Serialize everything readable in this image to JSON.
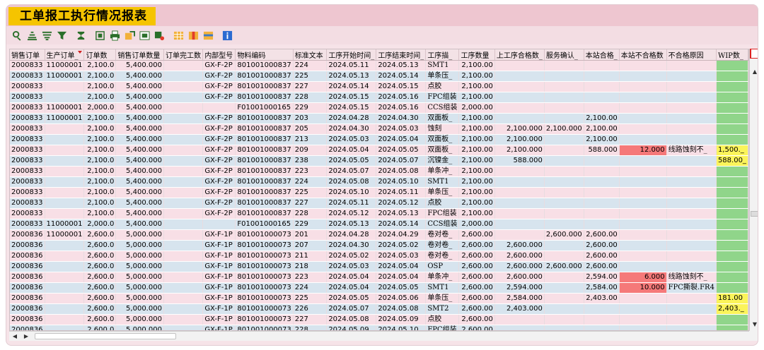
{
  "title": "工单报工执行情况报表",
  "toolbar": {
    "icons": [
      "details-icon",
      "sort-ascending-icon",
      "sort-descending-icon",
      "filter-icon",
      "sum-icon",
      "subtotal-icon",
      "print-icon",
      "export-icon",
      "spreadsheet-icon",
      "layout-icon",
      "grid-icon",
      "column-icon",
      "info-icon"
    ]
  },
  "colors": {
    "title_bg": "#f5c400",
    "row_pink": "#f8dfe6",
    "row_blue": "#d7e4ee",
    "red": "#f57979",
    "yellow": "#fbf45a",
    "wip": "#90d58a"
  },
  "table": {
    "headers": [
      "销售订单",
      "生产订单_",
      "订单数",
      "销售订单数量",
      "订单完工数",
      "内部型号",
      "物料编码",
      "标准文本",
      "工序开始时间_",
      "工序结束时间_",
      "工序描_",
      "工序数量",
      "上工序合格数_",
      "服务确认_",
      "本站合格_",
      "本站不合格数",
      "不合格原因",
      "WIP数_"
    ],
    "rows": [
      [
        "2000833",
        "11000001",
        "2,100.0",
        "5,400.000",
        "",
        "GX-F-2P",
        "801001000837",
        "224",
        "2024.05.11",
        "2024.05.13",
        "SMT1",
        "2,100.00",
        "",
        "",
        "",
        "",
        "",
        ""
      ],
      [
        "2000833",
        "11000001",
        "2,100.0",
        "5,400.000",
        "",
        "GX-F-2P",
        "801001000837",
        "225",
        "2024.05.13",
        "2024.05.14",
        "单条压_",
        "2,100.00",
        "",
        "",
        "",
        "",
        "",
        ""
      ],
      [
        "2000833",
        "",
        "2,100.0",
        "5,400.000",
        "",
        "GX-F-2P",
        "801001000837",
        "227",
        "2024.05.14",
        "2024.05.15",
        "点胶",
        "2,100.00",
        "",
        "",
        "",
        "",
        "",
        ""
      ],
      [
        "2000833",
        "",
        "2,100.0",
        "5,400.000",
        "",
        "GX-F-2P",
        "801001000837",
        "228",
        "2024.05.15",
        "2024.05.16",
        "FPC组装",
        "2,100.00",
        "",
        "",
        "",
        "",
        "",
        ""
      ],
      [
        "2000833",
        "11000001",
        "2,000.0",
        "5,400.000",
        "",
        "",
        "F01001000165",
        "229",
        "2024.05.15",
        "2024.05.16",
        "CCS组装",
        "2,000.00",
        "",
        "",
        "",
        "",
        "",
        ""
      ],
      [
        "2000833",
        "11000001",
        "2,100.0",
        "5,400.000",
        "",
        "GX-F-2P",
        "801001000837",
        "203",
        "2024.04.28",
        "2024.04.30",
        "双面板_",
        "2,100.00",
        "",
        "",
        "2,100.00",
        "",
        "",
        ""
      ],
      [
        "2000833",
        "",
        "2,100.0",
        "5,400.000",
        "",
        "GX-F-2P",
        "801001000837",
        "205",
        "2024.04.30",
        "2024.05.03",
        "蚀刻",
        "2,100.00",
        "2,100.000",
        "2,100.000",
        "2,100.00",
        "",
        "",
        ""
      ],
      [
        "2000833",
        "",
        "2,100.0",
        "5,400.000",
        "",
        "GX-F-2P",
        "801001000837",
        "213",
        "2024.05.03",
        "2024.05.04",
        "双面板_",
        "2,100.00",
        "2,100.000",
        "",
        "2,100.00",
        "",
        "",
        ""
      ],
      [
        "2000833",
        "",
        "2,100.0",
        "5,400.000",
        "",
        "GX-F-2P",
        "801001000837",
        "209",
        "2024.05.04",
        "2024.05.05",
        "双面板_",
        "2,100.00",
        "2,100.000",
        "",
        "588.000",
        "12.000",
        "线路蚀刻不_",
        "1,500._"
      ],
      [
        "2000833",
        "",
        "2,100.0",
        "5,400.000",
        "",
        "GX-F-2P",
        "801001000837",
        "238",
        "2024.05.05",
        "2024.05.07",
        "沉镍金_",
        "2,100.00",
        "588.000",
        "",
        "",
        "",
        "",
        "588.00_"
      ],
      [
        "2000833",
        "",
        "2,100.0",
        "5,400.000",
        "",
        "GX-F-2P",
        "801001000837",
        "223",
        "2024.05.07",
        "2024.05.08",
        "单条冲_",
        "2,100.00",
        "",
        "",
        "",
        "",
        "",
        ""
      ],
      [
        "2000833",
        "",
        "2,100.0",
        "5,400.000",
        "",
        "GX-F-2P",
        "801001000837",
        "224",
        "2024.05.08",
        "2024.05.10",
        "SMT1",
        "2,100.00",
        "",
        "",
        "",
        "",
        "",
        ""
      ],
      [
        "2000833",
        "",
        "2,100.0",
        "5,400.000",
        "",
        "GX-F-2P",
        "801001000837",
        "225",
        "2024.05.10",
        "2024.05.11",
        "单条压_",
        "2,100.00",
        "",
        "",
        "",
        "",
        "",
        ""
      ],
      [
        "2000833",
        "",
        "2,100.0",
        "5,400.000",
        "",
        "GX-F-2P",
        "801001000837",
        "227",
        "2024.05.11",
        "2024.05.12",
        "点胶",
        "2,100.00",
        "",
        "",
        "",
        "",
        "",
        ""
      ],
      [
        "2000833",
        "",
        "2,100.0",
        "5,400.000",
        "",
        "GX-F-2P",
        "801001000837",
        "228",
        "2024.05.12",
        "2024.05.13",
        "FPC组装",
        "2,100.00",
        "",
        "",
        "",
        "",
        "",
        ""
      ],
      [
        "2000833",
        "11000001",
        "2,000.0",
        "5,400.000",
        "",
        "",
        "F01001000165",
        "229",
        "2024.05.13",
        "2024.05.14",
        "CCS组装",
        "2,000.00",
        "",
        "",
        "",
        "",
        "",
        ""
      ],
      [
        "2000836",
        "11000001",
        "2,600.0",
        "5,000.000",
        "",
        "GX-F-1P",
        "801001000073",
        "201",
        "2024.04.28",
        "2024.04.29",
        "卷对卷_",
        "2,600.00",
        "",
        "2,600.000",
        "2,600.00",
        "",
        "",
        ""
      ],
      [
        "2000836",
        "",
        "2,600.0",
        "5,000.000",
        "",
        "GX-F-1P",
        "801001000073",
        "207",
        "2024.04.30",
        "2024.05.02",
        "卷对卷_",
        "2,600.00",
        "2,600.000",
        "",
        "2,600.00",
        "",
        "",
        ""
      ],
      [
        "2000836",
        "",
        "2,600.0",
        "5,000.000",
        "",
        "GX-F-1P",
        "801001000073",
        "211",
        "2024.05.02",
        "2024.05.03",
        "卷对卷_",
        "2,600.00",
        "2,600.000",
        "",
        "2,600.00",
        "",
        "",
        ""
      ],
      [
        "2000836",
        "",
        "2,600.0",
        "5,000.000",
        "",
        "GX-F-1P",
        "801001000073",
        "218",
        "2024.05.03",
        "2024.05.04",
        "OSP",
        "2,600.00",
        "2,600.000",
        "2,600.000",
        "2,600.00",
        "",
        "",
        ""
      ],
      [
        "2000836",
        "",
        "2,600.0",
        "5,000.000",
        "",
        "GX-F-1P",
        "801001000073",
        "223",
        "2024.05.04",
        "2024.05.04",
        "单条冲_",
        "2,600.00",
        "2,600.000",
        "",
        "2,594.00",
        "6.000",
        "线路蚀刻不_",
        ""
      ],
      [
        "2000836",
        "",
        "2,600.0",
        "5,000.000",
        "",
        "GX-F-1P",
        "801001000073",
        "224",
        "2024.05.04",
        "2024.05.05",
        "SMT1",
        "2,600.00",
        "2,594.000",
        "",
        "2,584.00",
        "10.000",
        "FPC撕裂.FR4",
        ""
      ],
      [
        "2000836",
        "",
        "2,600.0",
        "5,000.000",
        "",
        "GX-F-1P",
        "801001000073",
        "225",
        "2024.05.05",
        "2024.05.06",
        "单条压_",
        "2,600.00",
        "2,584.000",
        "",
        "2,403.00",
        "",
        "",
        "181.00"
      ],
      [
        "2000836",
        "",
        "2,600.0",
        "5,000.000",
        "",
        "GX-F-1P",
        "801001000073",
        "226",
        "2024.05.07",
        "2024.05.08",
        "SMT2",
        "2,600.00",
        "2,403.000",
        "",
        "",
        "",
        "",
        "2,403._"
      ],
      [
        "2000836",
        "",
        "2,600.0",
        "5,000.000",
        "",
        "GX-F-1P",
        "801001000073",
        "227",
        "2024.05.08",
        "2024.05.09",
        "点胶",
        "2,600.00",
        "",
        "",
        "",
        "",
        "",
        ""
      ],
      [
        "2000836",
        "",
        "2,600.0",
        "5,000.000",
        "",
        "GX-F-1P",
        "801001000073",
        "228",
        "2024.05.09",
        "2024.05.10",
        "FPC组装",
        "2,600.00",
        "",
        "",
        "",
        "",
        "",
        ""
      ]
    ]
  }
}
